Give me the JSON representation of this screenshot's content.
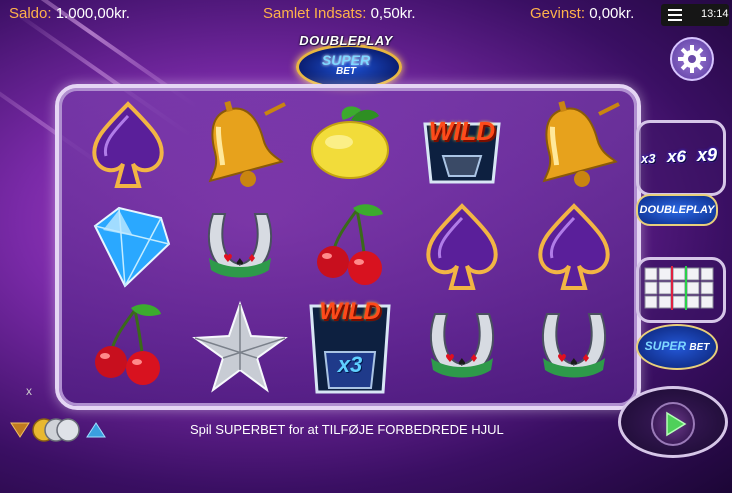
{
  "topbar": {
    "saldo_label": "Saldo:",
    "saldo_value": "1.000,00kr.",
    "insats_label": "Samlet Indsats:",
    "insats_value": "0,50kr.",
    "gevinst_label": "Gevinst:",
    "gevinst_value": "0,00kr.",
    "clock": "13:14",
    "menu_icon": "hamburger-icon"
  },
  "logo": {
    "line1": "DOUBLEPLAY",
    "line2": "SUPER",
    "line3": "BET"
  },
  "settings_icon": "gear-icon",
  "reels": [
    [
      "spade",
      "bell",
      "lemon",
      "wild",
      "bell"
    ],
    [
      "diamond",
      "horseshoe",
      "cherry",
      "spade",
      "spade"
    ],
    [
      "cherry",
      "star",
      "wild-x3",
      "horseshoe",
      "horseshoe"
    ]
  ],
  "symbol_text": {
    "wild": "WILD",
    "wild_x3_mult": "x3"
  },
  "side_panel": {
    "multipliers": [
      "x3",
      "x6",
      "x9"
    ],
    "doubleplay_label": "DOUBLEPLAY",
    "superbet_line1": "SUPER",
    "superbet_line2": "BET"
  },
  "controls": {
    "spin_icon": "play-icon",
    "close_label": "x",
    "coin_icons": [
      "arrow-down-icon",
      "coin-stack-icon",
      "arrow-up-icon"
    ]
  },
  "message": "Spil SUPERBET for at TILFØJE FORBEDREDE HJUL",
  "colors": {
    "label_orange": "#ffb24a",
    "background_purple": "#7a2aa8",
    "spin_green": "#4fd05a"
  }
}
